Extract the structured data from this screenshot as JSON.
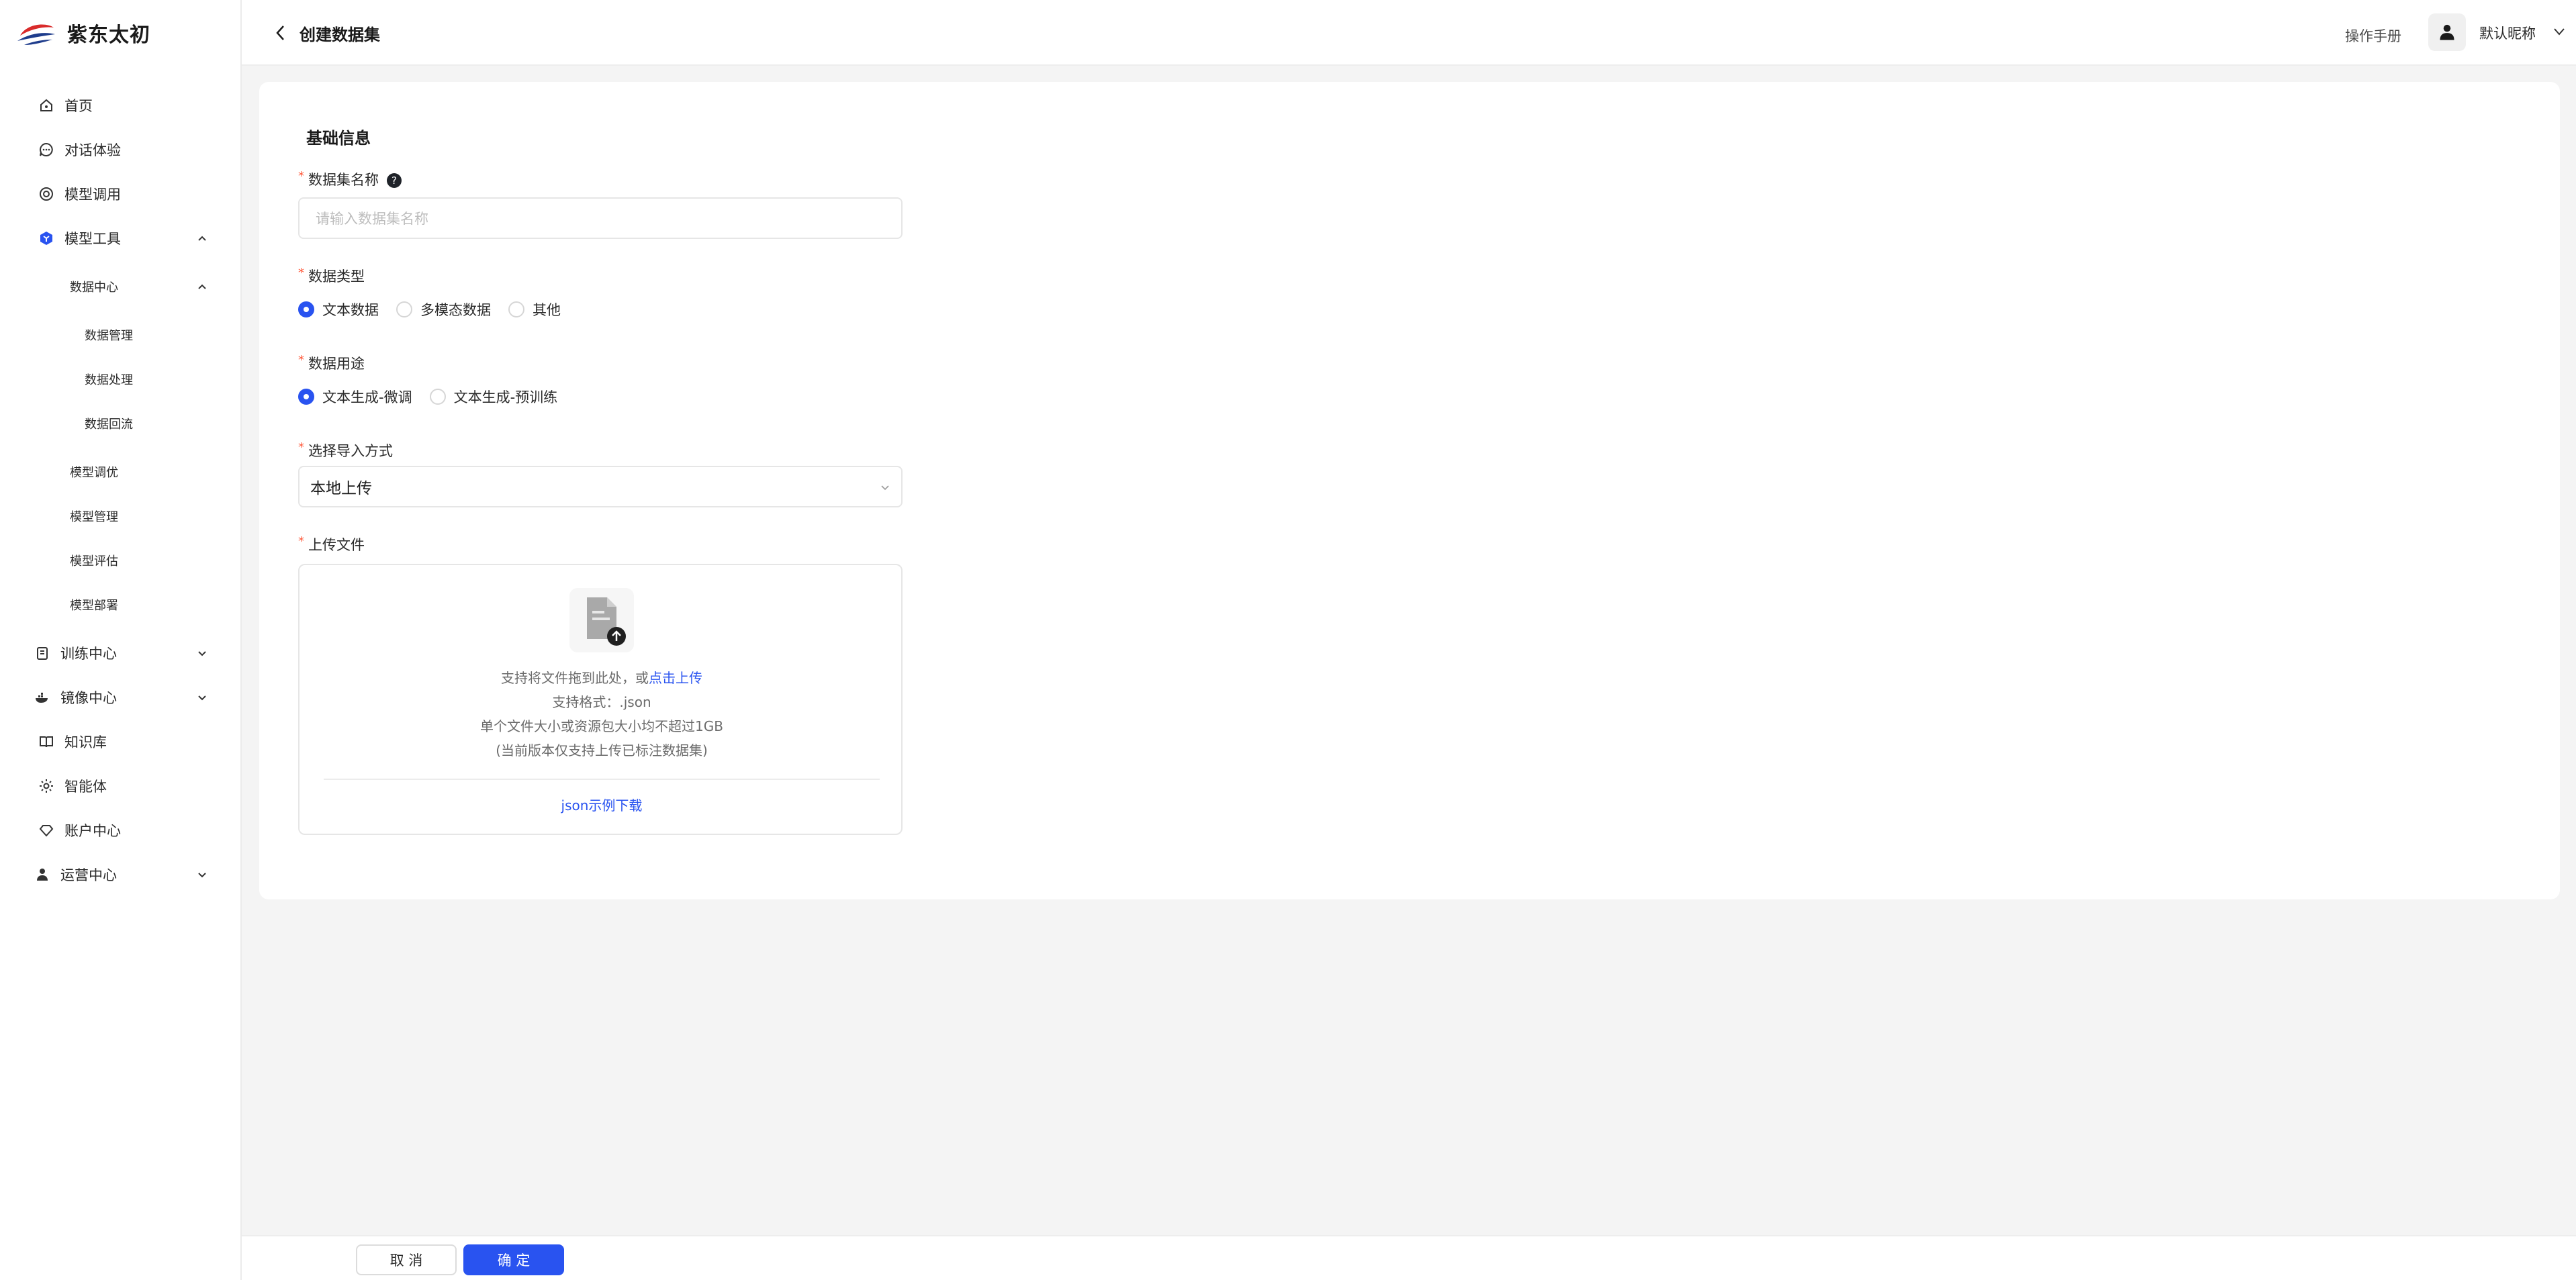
{
  "brand": {
    "name": "紫东太初"
  },
  "sidebar": {
    "items": [
      {
        "label": "首页",
        "icon": "home-icon"
      },
      {
        "label": "对话体验",
        "icon": "chat-icon"
      },
      {
        "label": "模型调用",
        "icon": "model-call-icon"
      },
      {
        "label": "模型工具",
        "icon": "cube-icon",
        "expanded": true,
        "active": true
      },
      {
        "label": "数据中心",
        "expanded": true
      },
      {
        "label": "数据管理"
      },
      {
        "label": "数据处理"
      },
      {
        "label": "数据回流"
      },
      {
        "label": "模型调优"
      },
      {
        "label": "模型管理"
      },
      {
        "label": "模型评估"
      },
      {
        "label": "模型部署"
      },
      {
        "label": "训练中心",
        "icon": "training-icon",
        "expanded": false
      },
      {
        "label": "镜像中心",
        "icon": "whale-icon",
        "expanded": false
      },
      {
        "label": "知识库",
        "icon": "book-icon"
      },
      {
        "label": "智能体",
        "icon": "agent-gear-icon"
      },
      {
        "label": "账户中心",
        "icon": "account-icon"
      },
      {
        "label": "运营中心",
        "icon": "operator-icon",
        "expanded": false
      }
    ]
  },
  "header": {
    "title": "创建数据集",
    "manual": "操作手册",
    "username": "默认昵称"
  },
  "form": {
    "section_title": "基础信息",
    "name_label": "数据集名称",
    "name_placeholder": "请输入数据集名称",
    "type_label": "数据类型",
    "type_options": [
      "文本数据",
      "多模态数据",
      "其他"
    ],
    "type_selected": "文本数据",
    "usage_label": "数据用途",
    "usage_options": [
      "文本生成-微调",
      "文本生成-预训练"
    ],
    "usage_selected": "文本生成-微调",
    "import_label": "选择导入方式",
    "import_value": "本地上传",
    "upload_label": "上传文件",
    "upload": {
      "hint_prefix": "支持将文件拖到此处，或",
      "hint_link": "点击上传",
      "formats": "支持格式：.json",
      "size_limit": "单个文件大小或资源包大小均不超过1GB",
      "note": "(当前版本仅支持上传已标注数据集)",
      "sample_link": "json示例下载"
    }
  },
  "footer": {
    "cancel": "取 消",
    "confirm": "确 定"
  },
  "colors": {
    "accent": "#2953f0",
    "required": "#ff5a3c"
  }
}
